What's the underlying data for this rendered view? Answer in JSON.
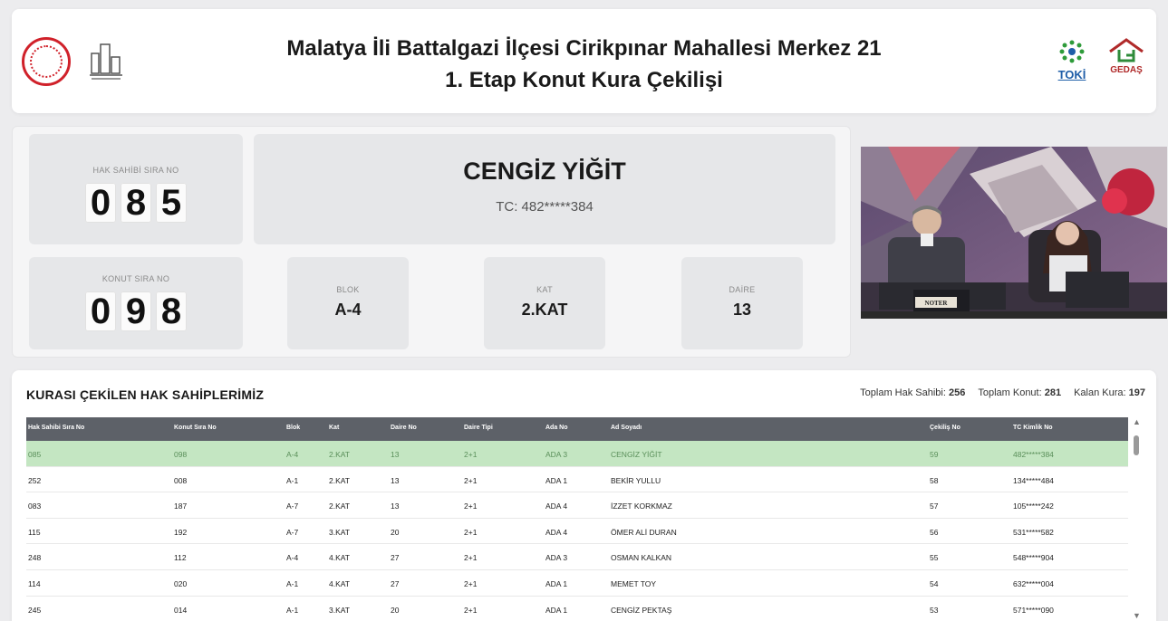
{
  "header": {
    "title_line1": "Malatya İli Battalgazi İlçesi Cirikpınar Mahallesi Merkez 21",
    "title_line2": "1. Etap Konut Kura Çekilişi",
    "logos": {
      "toki": "TOKİ",
      "gedas": "GEDAŞ"
    }
  },
  "current": {
    "hak_sahibi_label": "HAK SAHİBİ SIRA NO",
    "hak_sahibi_digits": [
      "0",
      "8",
      "5"
    ],
    "konut_label": "KONUT SIRA NO",
    "konut_digits": [
      "0",
      "9",
      "8"
    ],
    "name": "CENGİZ YİĞİT",
    "tc": "TC: 482*****384",
    "blok_label": "BLOK",
    "blok": "A-4",
    "kat_label": "KAT",
    "kat": "2.KAT",
    "daire_label": "DAİRE",
    "daire": "13"
  },
  "video": {
    "noter_label": "NOTER"
  },
  "list": {
    "title": "KURASI ÇEKİLEN HAK SAHİPLERİMİZ",
    "stats": [
      {
        "label": "Toplam Hak Sahibi:",
        "value": "256"
      },
      {
        "label": "Toplam Konut:",
        "value": "281"
      },
      {
        "label": "Kalan Kura:",
        "value": "197"
      }
    ],
    "columns": [
      "Hak Sahibi Sıra No",
      "Konut Sıra No",
      "Blok",
      "Kat",
      "Daire No",
      "Daire Tipi",
      "Ada No",
      "Ad Soyadı",
      "Çekiliş No",
      "TC Kimlik No"
    ],
    "rows": [
      [
        "085",
        "098",
        "A-4",
        "2.KAT",
        "13",
        "2+1",
        "ADA 3",
        "CENGİZ YİĞİT",
        "59",
        "482*****384"
      ],
      [
        "252",
        "008",
        "A-1",
        "2.KAT",
        "13",
        "2+1",
        "ADA 1",
        "BEKİR YULLU",
        "58",
        "134*****484"
      ],
      [
        "083",
        "187",
        "A-7",
        "2.KAT",
        "13",
        "2+1",
        "ADA 4",
        "İZZET KORKMAZ",
        "57",
        "105*****242"
      ],
      [
        "115",
        "192",
        "A-7",
        "3.KAT",
        "20",
        "2+1",
        "ADA 4",
        "ÖMER ALİ DURAN",
        "56",
        "531*****582"
      ],
      [
        "248",
        "112",
        "A-4",
        "4.KAT",
        "27",
        "2+1",
        "ADA 3",
        "OSMAN KALKAN",
        "55",
        "548*****904"
      ],
      [
        "114",
        "020",
        "A-1",
        "4.KAT",
        "27",
        "2+1",
        "ADA 1",
        "MEMET TOY",
        "54",
        "632*****004"
      ],
      [
        "245",
        "014",
        "A-1",
        "3.KAT",
        "20",
        "2+1",
        "ADA 1",
        "CENGİZ PEKTAŞ",
        "53",
        "571*****090"
      ]
    ]
  },
  "colors": {
    "highlight_row": "#c4e6c2",
    "table_header": "#5d6168"
  }
}
